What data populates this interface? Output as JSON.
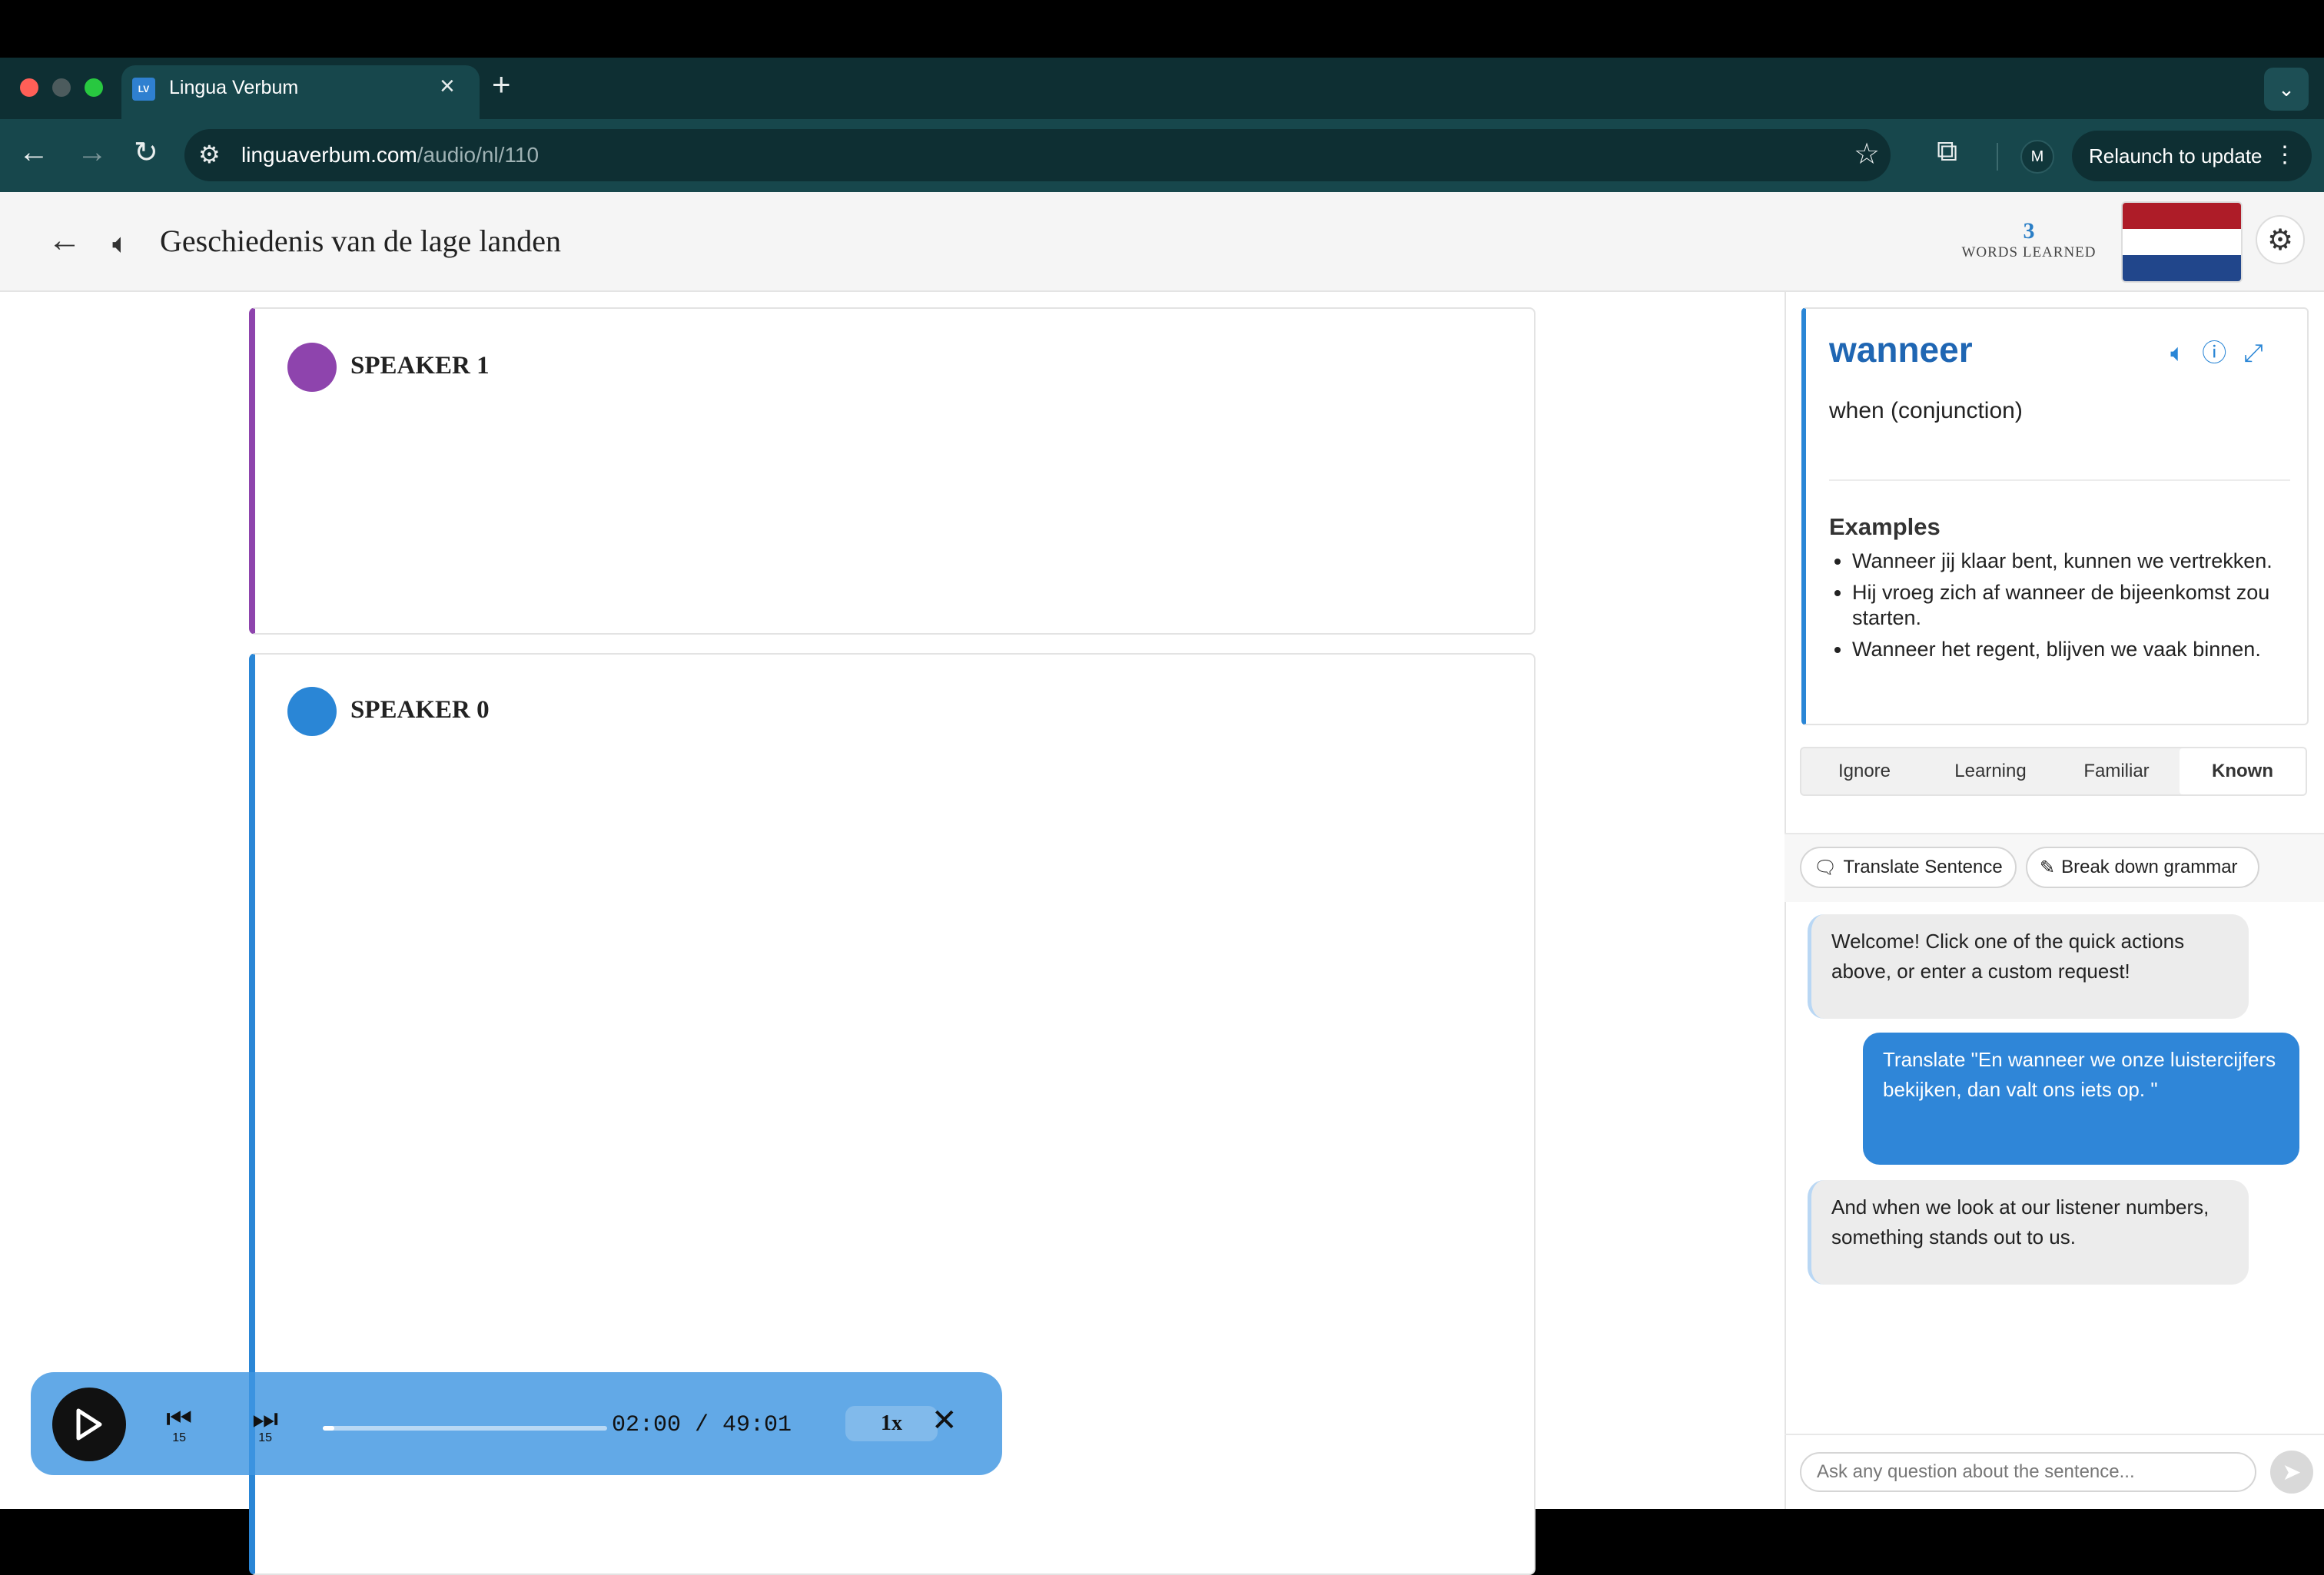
{
  "browser": {
    "tab_title": "Lingua Verbum",
    "tab_favicon": "LV",
    "url_host": "linguaverbum.com",
    "url_path": "/audio/nl/110",
    "profile_initial": "M",
    "relaunch_label": "Relaunch to update"
  },
  "header": {
    "title": "Geschiedenis van de lage landen",
    "words_learned_count": "3",
    "words_learned_label": "WORDS LEARNED",
    "flag_colors": [
      "#ae1c28",
      "#ffffff",
      "#21468b"
    ]
  },
  "transcript": {
    "speakers": [
      {
        "label": "SPEAKER 1",
        "color": "#8e44ad"
      },
      {
        "label": "SPEAKER 0",
        "color": "#2a86d6"
      }
    ]
  },
  "player": {
    "skip_back": "15",
    "skip_forward": "15",
    "time": "02:00 / 49:01",
    "progress_fraction": 0.04,
    "speed": "1x"
  },
  "word_panel": {
    "word": "wanneer",
    "definition": "when (conjunction)",
    "examples_heading": "Examples",
    "examples": [
      "Wanneer jij klaar bent, kunnen we vertrekken.",
      "Hij vroeg zich af wanneer de bijeenkomst zou starten.",
      "Wanneer het regent, blijven we vaak binnen."
    ],
    "status_options": [
      "Ignore",
      "Learning",
      "Familiar",
      "Known"
    ],
    "status_selected": "Known"
  },
  "chat": {
    "actions": [
      "Translate Sentence",
      "Break down grammar"
    ],
    "messages": [
      {
        "role": "ai",
        "text": "Welcome! Click one of the quick actions above, or enter a custom request!"
      },
      {
        "role": "user",
        "text": "Translate \"En wanneer we onze luistercijfers bekijken, dan valt ons iets op. \""
      },
      {
        "role": "ai",
        "text": "And when we look at our listener numbers, something stands out to us."
      }
    ],
    "input_placeholder": "Ask any question about the sentence..."
  }
}
